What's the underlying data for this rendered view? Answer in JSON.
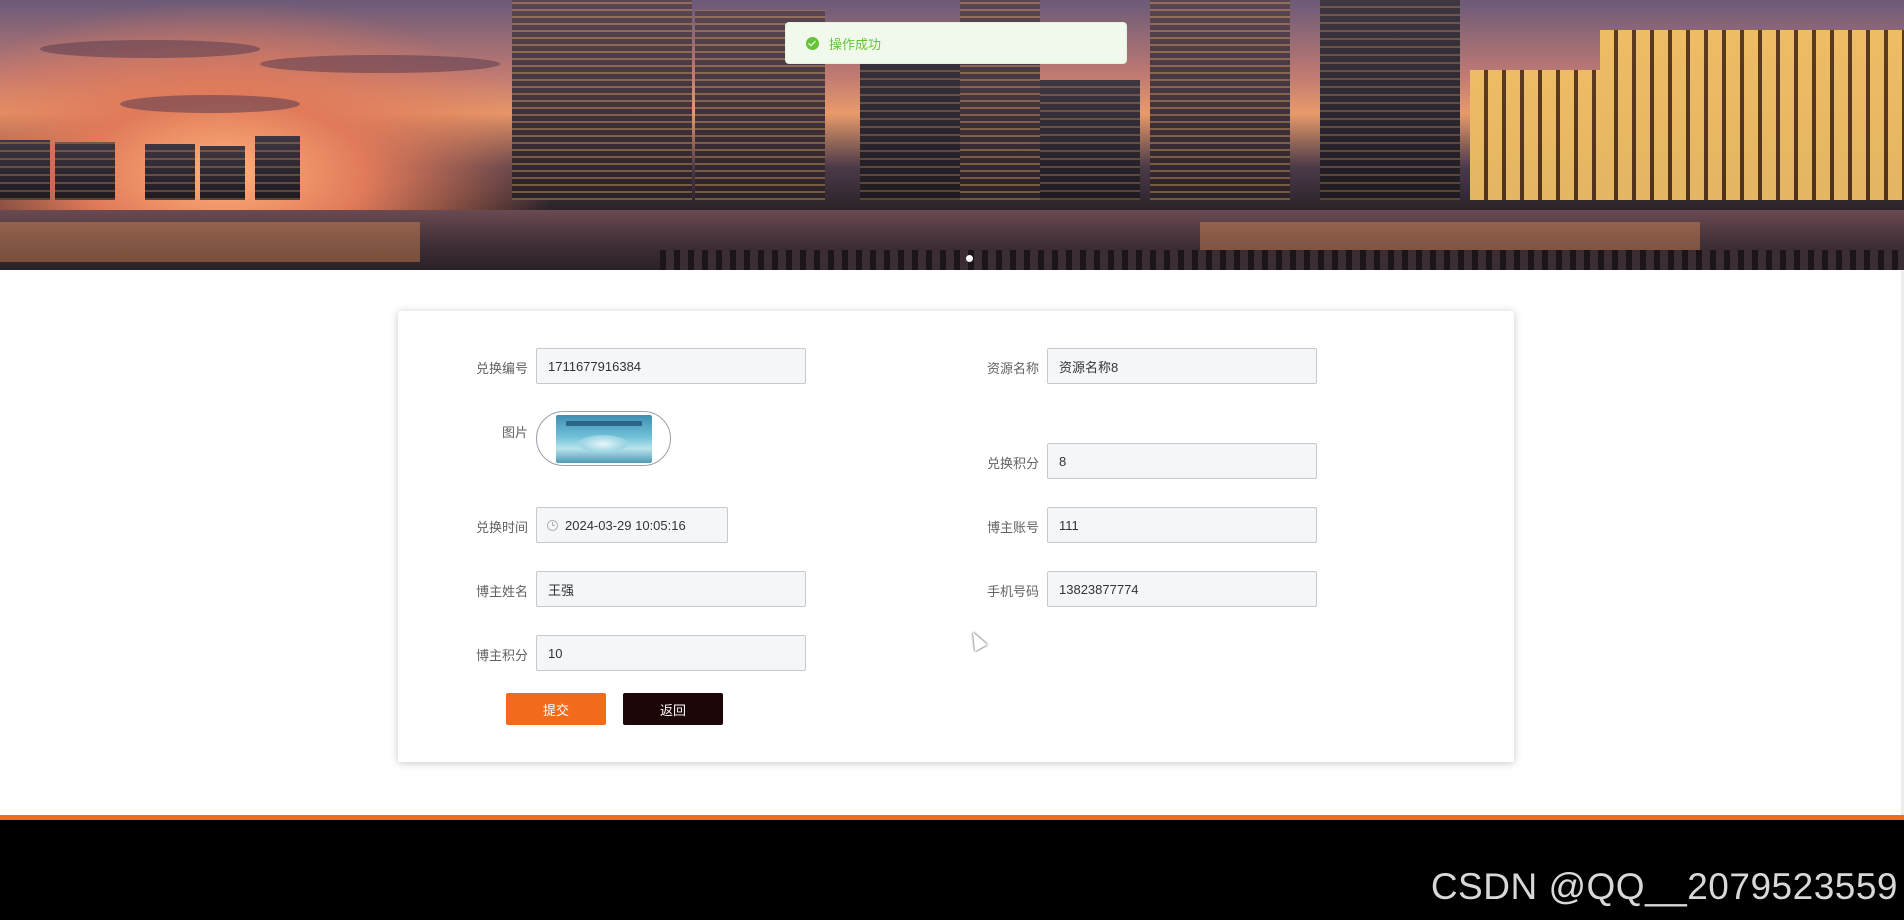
{
  "toast": {
    "message": "操作成功",
    "icon": "success-check-icon",
    "color": "#67c23a"
  },
  "form": {
    "exchange_no": {
      "label": "兑换编号",
      "value": "1711677916384"
    },
    "resource_name": {
      "label": "资源名称",
      "value": "资源名称8"
    },
    "image": {
      "label": "图片"
    },
    "exchange_points": {
      "label": "兑换积分",
      "value": "8"
    },
    "exchange_time": {
      "label": "兑换时间",
      "value": "2024-03-29 10:05:16",
      "icon": "clock-icon"
    },
    "blogger_account": {
      "label": "博主账号",
      "value": "111"
    },
    "blogger_name": {
      "label": "博主姓名",
      "value": "王强"
    },
    "phone": {
      "label": "手机号码",
      "value": "13823877774"
    },
    "blogger_points": {
      "label": "博主积分",
      "value": "10"
    }
  },
  "buttons": {
    "submit": "提交",
    "back": "返回"
  },
  "colors": {
    "accent": "#f26b1d",
    "back_button": "#1c0608",
    "footer": "#000000"
  },
  "watermark": "CSDN @QQ__2079523559"
}
